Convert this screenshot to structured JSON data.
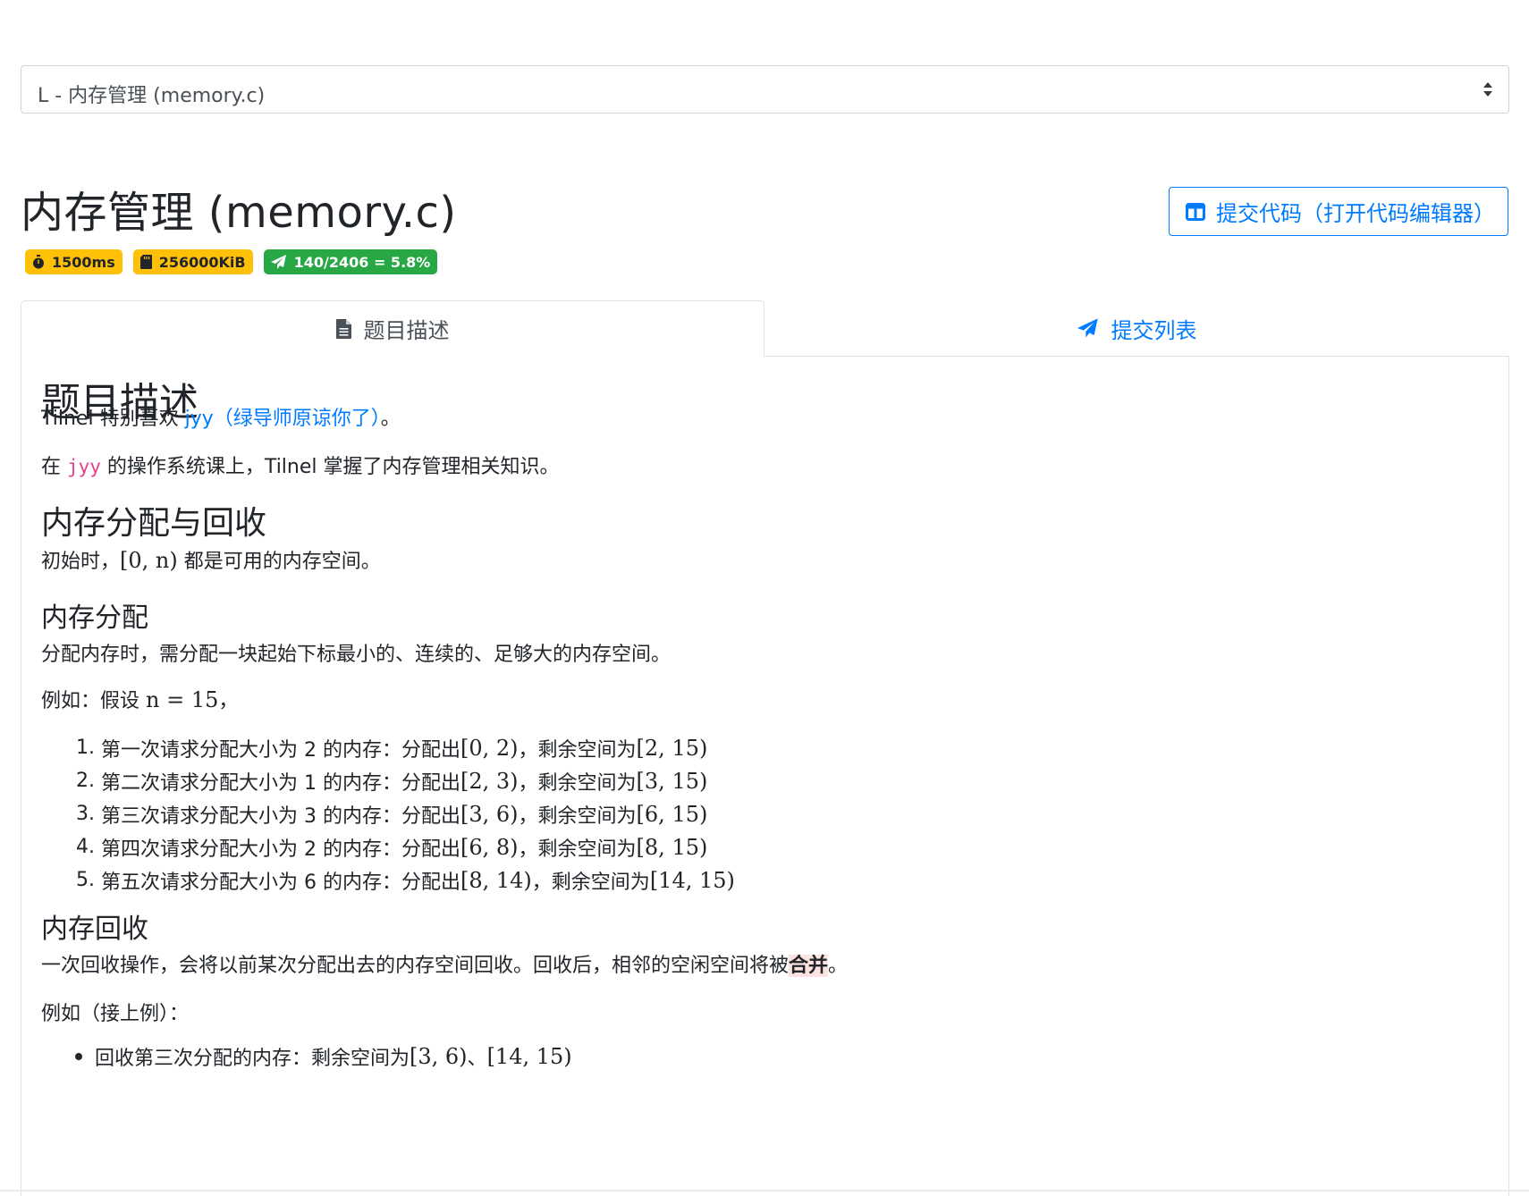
{
  "problem_select": {
    "value": "L - 内存管理 (memory.c)"
  },
  "title": "内存管理 (memory.c)",
  "submit_button": {
    "label": "提交代码（打开代码编辑器）"
  },
  "badges": {
    "time": "1500ms",
    "memory": "256000KiB",
    "accepted": "140/2406 = 5.8%"
  },
  "tabs": {
    "description": "题目描述",
    "submissions": "提交列表"
  },
  "colors": {
    "primary": "#007bff",
    "warning": "#ffc107",
    "success": "#28a745",
    "code": "#e83e8c"
  },
  "content": {
    "heading": "题目描述",
    "intro_pre": "Tilnel 特别喜欢 ",
    "intro_link": "jyy（绿导师原谅你了）",
    "intro_post": "。",
    "line2_pre": "在 ",
    "line2_code": "jyy",
    "line2_post": " 的操作系统课上，Tilnel 掌握了内存管理相关知识。",
    "section_alloc_free": "内存分配与回收",
    "init_pre": "初始时，",
    "init_math": "[0, n)",
    "init_post": " 都是可用的内存空间。",
    "sub_alloc": "内存分配",
    "alloc_desc": "分配内存时，需分配一块起始下标最小的、连续的、足够大的内存空间。",
    "example_pre": "例如：假设 ",
    "example_math": "n = 15",
    "example_post": "，",
    "alloc_steps": [
      {
        "num": "1.",
        "text": "第一次请求分配大小为 2 的内存：分配出 ",
        "a": "[0, 2)",
        "mid": "，剩余空间为 ",
        "b": "[2, 15)"
      },
      {
        "num": "2.",
        "text": "第二次请求分配大小为 1 的内存：分配出 ",
        "a": "[2, 3)",
        "mid": "，剩余空间为 ",
        "b": "[3, 15)"
      },
      {
        "num": "3.",
        "text": "第三次请求分配大小为 3 的内存：分配出 ",
        "a": "[3, 6)",
        "mid": "，剩余空间为 ",
        "b": "[6, 15)"
      },
      {
        "num": "4.",
        "text": "第四次请求分配大小为 2 的内存：分配出 ",
        "a": "[6, 8)",
        "mid": "，剩余空间为 ",
        "b": "[8, 15)"
      },
      {
        "num": "5.",
        "text": "第五次请求分配大小为 6 的内存：分配出 ",
        "a": "[8, 14)",
        "mid": "，剩余空间为 ",
        "b": "[14, 15)"
      }
    ],
    "sub_free": "内存回收",
    "free_desc_pre": "一次回收操作，会将以前某次分配出去的内存空间回收。回收后，相邻的空闲空间将被",
    "free_desc_mark": "合并",
    "free_desc_post": "。",
    "free_example": "例如（接上例）：",
    "free_steps": [
      {
        "text": "回收第三次分配的内存：剩余空间为 ",
        "a": "[3, 6)",
        "mid": "、",
        "b": "[14, 15)"
      }
    ]
  }
}
